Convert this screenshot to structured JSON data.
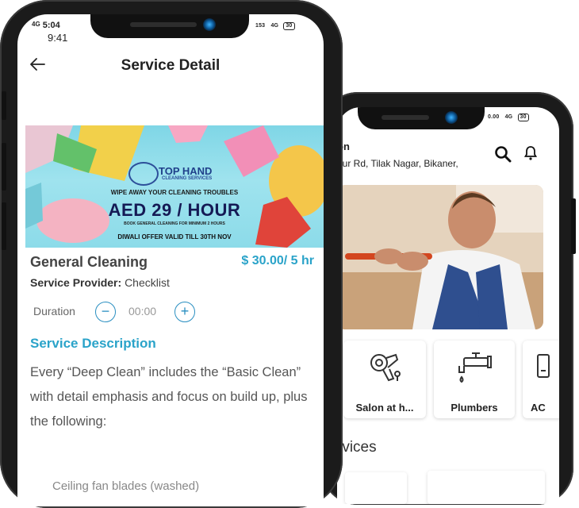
{
  "front_status": {
    "left": "5:04",
    "time": "9:41",
    "right_rate": "153",
    "net": "4G",
    "battery": "30"
  },
  "detail": {
    "title": "Service Detail",
    "banner": {
      "brand": "TOP HAND",
      "brand_sub": "CLEANING SERVICES",
      "tagline": "WIPE AWAY YOUR CLEANING TROUBLES",
      "offer": "AED 29 / HOUR",
      "note": "BOOK GENERAL CLEANING FOR MINIMUM 2 HOURS",
      "diwali": "DIWALI OFFER VALID TILL 30TH NOV"
    },
    "service_name": "General Cleaning",
    "price": "$ 30.00/ 5 hr",
    "provider_label": "Service Provider:",
    "provider_value": "Checklist",
    "duration_label": "Duration",
    "duration_value": "00:00",
    "minus": "−",
    "plus": "+",
    "description_heading": "Service Description",
    "description": "Every “Deep Clean” includes the “Basic Clean” with detail emphasis and focus on build up, plus the following:",
    "bullet": "Ceiling fan blades (washed)"
  },
  "back_status": {
    "rate": "0.00",
    "net": "4G",
    "battery": "30"
  },
  "home": {
    "location_title": "on",
    "location_address": "bur Rd, Tilak Nagar, Bikaner,",
    "categories": [
      {
        "label": "Salon at h...",
        "icon": "hair-dryer-icon"
      },
      {
        "label": "Plumbers",
        "icon": "faucet-icon"
      },
      {
        "label": "AC",
        "icon": "ac-icon"
      }
    ],
    "section_heading": "rvices"
  },
  "colors": {
    "accent": "#2aa3c9",
    "frame": "#1b1b1b",
    "banner_bg": "#8cdbe9"
  }
}
